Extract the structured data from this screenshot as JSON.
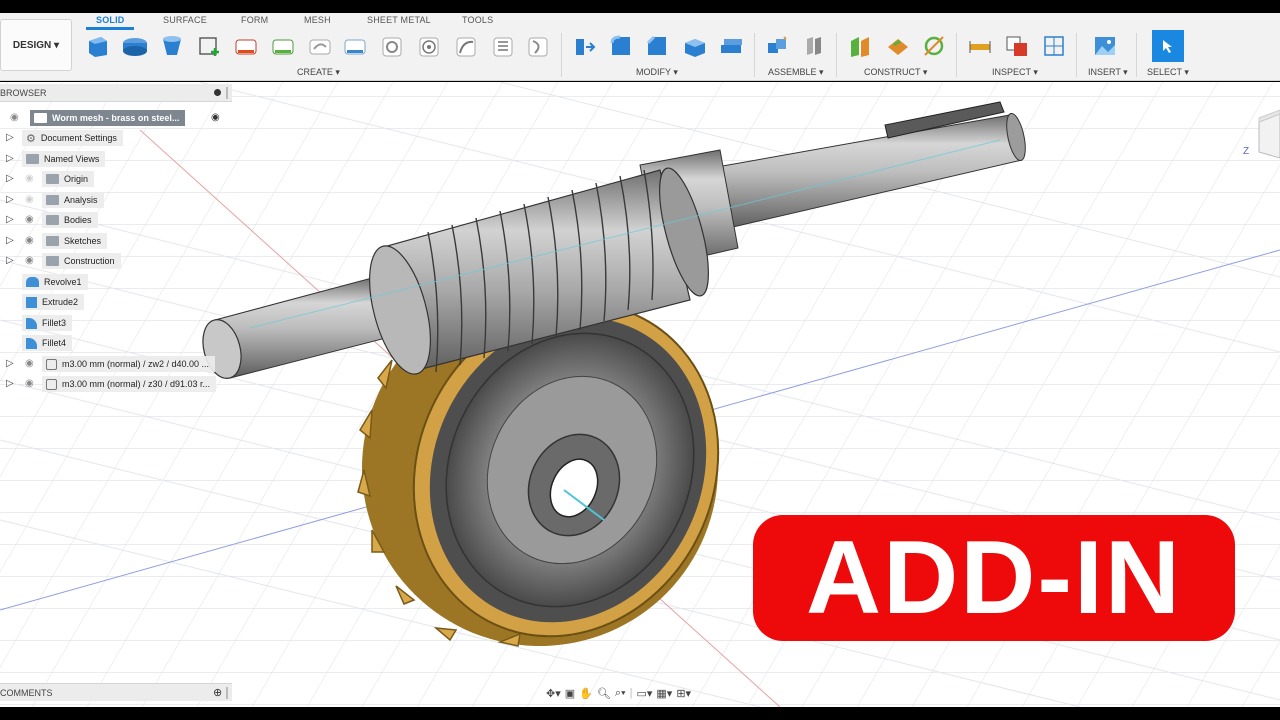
{
  "workspace": {
    "design_label": "DESIGN ▾"
  },
  "tabs": [
    "SOLID",
    "SURFACE",
    "FORM",
    "MESH",
    "SHEET METAL",
    "TOOLS"
  ],
  "groups": {
    "create": "CREATE ▾",
    "modify": "MODIFY ▾",
    "assemble": "ASSEMBLE ▾",
    "construct": "CONSTRUCT ▾",
    "inspect": "INSPECT ▾",
    "insert": "INSERT ▾",
    "select": "SELECT ▾"
  },
  "browser": {
    "title": "BROWSER",
    "root": "Worm mesh - brass on steel...",
    "items": [
      {
        "label": "Document Settings",
        "icon": "gear-icon"
      },
      {
        "label": "Named Views",
        "icon": "folder-icon"
      },
      {
        "label": "Origin",
        "icon": "folder-icon"
      },
      {
        "label": "Analysis",
        "icon": "folder-icon"
      },
      {
        "label": "Bodies",
        "icon": "folder-icon"
      },
      {
        "label": "Sketches",
        "icon": "folder-icon"
      },
      {
        "label": "Construction",
        "icon": "folder-icon"
      },
      {
        "label": "Revolve1",
        "icon": "revolve-icon"
      },
      {
        "label": "Extrude2",
        "icon": "extrude-icon"
      },
      {
        "label": "Fillet3",
        "icon": "fillet-icon"
      },
      {
        "label": "Fillet4",
        "icon": "fillet-icon"
      },
      {
        "label": "m3.00 mm (normal) / zw2 / d40.00 ...",
        "icon": "component-icon"
      },
      {
        "label": "m3.00 mm (normal) / z30 / d91.03 r...",
        "icon": "component-icon"
      }
    ]
  },
  "comments": {
    "title": "COMMENTS"
  },
  "viewcube": {
    "axis_label": "Z"
  },
  "badge": {
    "text": "ADD-IN"
  },
  "colors": {
    "accent": "#1a7fd6",
    "badge": "#ee0a0a",
    "brass": "#c9962f",
    "steel": "#9a9a9a"
  }
}
